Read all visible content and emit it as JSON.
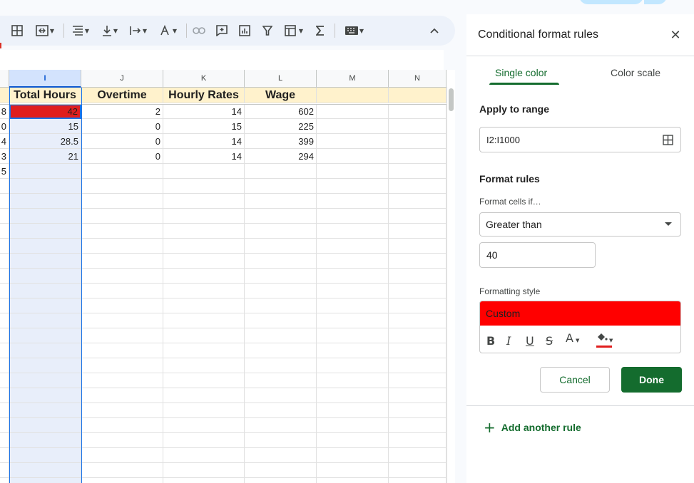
{
  "toolbar": {
    "icons": [
      "borders-icon",
      "merge-cells-icon",
      "horizontal-align-icon",
      "vertical-align-icon",
      "text-wrap-icon",
      "text-rotation-icon",
      "link-icon",
      "comment-icon",
      "chart-icon",
      "filter-icon",
      "table-views-icon",
      "functions-icon",
      "input-tools-icon",
      "collapse-icon"
    ]
  },
  "grid": {
    "columns": [
      {
        "letter": "",
        "selected": false
      },
      {
        "letter": "I",
        "selected": true
      },
      {
        "letter": "J",
        "selected": false
      },
      {
        "letter": "K",
        "selected": false
      },
      {
        "letter": "L",
        "selected": false
      },
      {
        "letter": "M",
        "selected": false
      },
      {
        "letter": "N",
        "selected": false
      }
    ],
    "header_row": [
      "",
      "Total Hours",
      "Overtime",
      "Hourly Rates",
      "Wage",
      "",
      ""
    ],
    "rows": [
      [
        "8",
        "42",
        "2",
        "14",
        "602",
        "",
        ""
      ],
      [
        "0",
        "15",
        "0",
        "15",
        "225",
        "",
        ""
      ],
      [
        "4",
        "28.5",
        "0",
        "14",
        "399",
        "",
        ""
      ],
      [
        "3",
        "21",
        "0",
        "14",
        "294",
        "",
        ""
      ],
      [
        "5",
        "",
        "",
        "",
        "",
        "",
        ""
      ]
    ]
  },
  "panel": {
    "title": "Conditional format rules",
    "tabs": [
      "Single color",
      "Color scale"
    ],
    "active_tab": "Single color",
    "apply_range_label": "Apply to range",
    "apply_range_value": "I2:I1000",
    "format_rules_label": "Format rules",
    "format_cells_if_label": "Format cells if…",
    "condition": "Greater than",
    "value": "40",
    "formatting_style_label": "Formatting style",
    "style_name": "Custom",
    "style_color": "#ff0000",
    "cancel_label": "Cancel",
    "done_label": "Done",
    "add_rule_label": "Add another rule"
  },
  "colors": {
    "accent_green": "#146c2e",
    "header_fill": "#fff2cc",
    "highlight_red": "#e01e1e",
    "selection_blue": "#1a73e8"
  }
}
